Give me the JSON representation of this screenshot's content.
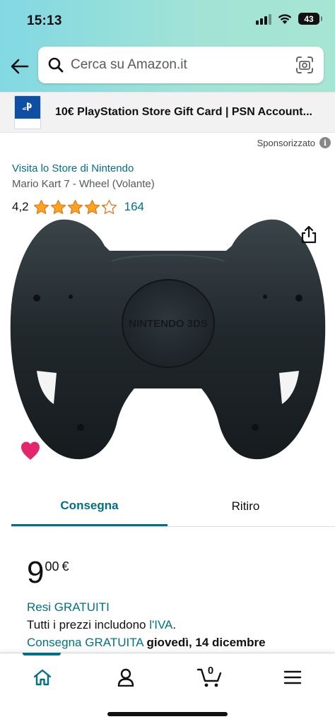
{
  "status_bar": {
    "time": "15:13",
    "battery_level": "43",
    "icons": [
      "cellular-signal-icon",
      "wifi-icon",
      "battery-icon"
    ]
  },
  "header": {
    "back_icon": "arrow-left-icon",
    "search_placeholder": "Cerca su Amazon.it",
    "search_icon": "search-icon",
    "camera_icon": "camera-scan-icon"
  },
  "sponsored_banner": {
    "text": "10€ PlayStation Store Gift Card | PSN Account...",
    "thumb_brand_color": "#0e4ea3"
  },
  "sponsored": {
    "label": "Sponsorizzato",
    "info_icon": "info-icon"
  },
  "product": {
    "store_link": "Visita lo Store di Nintendo",
    "title": "Mario Kart 7 - Wheel (Volante)",
    "rating_value": "4,2",
    "rating_stars": 4.2,
    "rating_count": "164",
    "image_brand_text": "NINTENDO 3DS",
    "share_icon": "share-icon",
    "wishlist_icon": "heart-icon",
    "wishlist_color": "#e3266d"
  },
  "tabs": {
    "delivery": "Consegna",
    "pickup": "Ritiro"
  },
  "price": {
    "whole": "9",
    "fraction": "00",
    "currency": "€"
  },
  "info_lines": {
    "returns": "Resi GRATUITI",
    "vat_prefix": "Tutti i prezzi includono ",
    "vat_link": "l'IVA",
    "vat_suffix": ".",
    "delivery_prefix": "Consegna GRATUITA",
    "delivery_date": "giovedì, 14 dicembre"
  },
  "bottom_nav": {
    "items": [
      "home-icon",
      "account-icon",
      "cart-icon",
      "menu-icon"
    ],
    "cart_count": "0"
  },
  "colors": {
    "accent": "#007185",
    "header_gradient_start": "#82d8e3",
    "header_gradient_end": "#a7e5d3",
    "star": "#ffa41c"
  }
}
